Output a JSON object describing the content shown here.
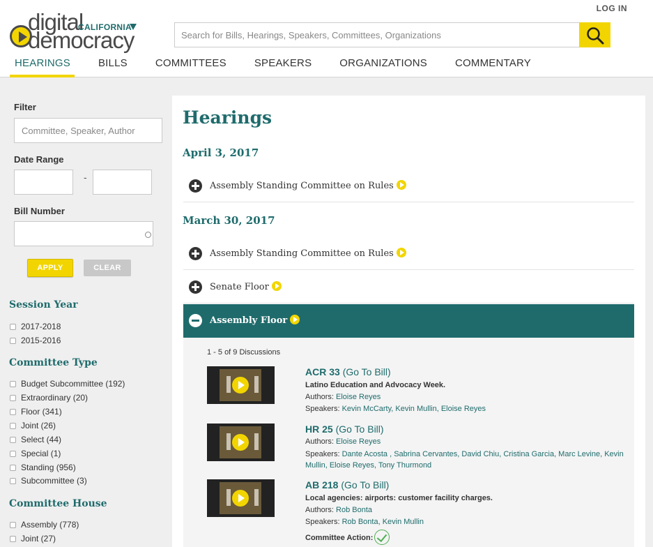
{
  "header": {
    "login": "LOG IN",
    "logo": {
      "line1": "digital",
      "line2": "democracy",
      "state": "CALIFORNIA"
    },
    "search_placeholder": "Search for Bills, Hearings, Speakers, Committees, Organizations",
    "nav": [
      "HEARINGS",
      "BILLS",
      "COMMITTEES",
      "SPEAKERS",
      "ORGANIZATIONS",
      "COMMENTARY"
    ],
    "active_nav": "HEARINGS"
  },
  "sidebar": {
    "filter_label": "Filter",
    "filter_placeholder": "Committee, Speaker, Author",
    "date_range_label": "Date Range",
    "date_sep": "-",
    "bill_number_label": "Bill Number",
    "apply": "APPLY",
    "clear": "CLEAR",
    "session_year": {
      "title": "Session Year",
      "items": [
        "2017-2018",
        "2015-2016"
      ]
    },
    "committee_type": {
      "title": "Committee Type",
      "items": [
        "Budget Subcommittee (192)",
        "Extraordinary (20)",
        "Floor (341)",
        "Joint (26)",
        "Select (44)",
        "Special (1)",
        "Standing (956)",
        "Subcommittee (3)"
      ]
    },
    "committee_house": {
      "title": "Committee House",
      "items": [
        "Assembly (778)",
        "Joint (27)"
      ]
    }
  },
  "main": {
    "title": "Hearings",
    "dates": [
      "April 3, 2017",
      "March 30, 2017"
    ],
    "hearings": [
      "Assembly Standing Committee on Rules",
      "Assembly Standing Committee on Rules",
      "Senate Floor",
      "Assembly Floor"
    ],
    "discussion_count": "1 - 5 of 9 Discussions",
    "discussions": [
      {
        "bill": "ACR 33",
        "go": "(Go To Bill)",
        "desc": "Latino Education and Advocacy Week.",
        "authors_label": "Authors:",
        "authors": "Eloise Reyes",
        "speakers_label": "Speakers:",
        "speakers": "Kevin McCarty, Kevin Mullin, Eloise Reyes"
      },
      {
        "bill": "HR 25",
        "go": "(Go To Bill)",
        "authors_label": "Authors:",
        "authors": "Eloise Reyes",
        "speakers_label": "Speakers:",
        "speakers": "Dante Acosta , Sabrina Cervantes, David Chiu, Cristina Garcia, Marc Levine, Kevin Mullin, Eloise Reyes, Tony Thurmond"
      },
      {
        "bill": "AB 218",
        "go": "(Go To Bill)",
        "desc": "Local agencies: airports: customer facility charges.",
        "authors_label": "Authors:",
        "authors": "Rob Bonta",
        "speakers_label": "Speakers:",
        "speakers": "Rob Bonta, Kevin Mullin",
        "action_label": "Committee Action:"
      }
    ]
  },
  "colors": {
    "teal": "#1f6b6c",
    "yellow": "#f2d500"
  }
}
